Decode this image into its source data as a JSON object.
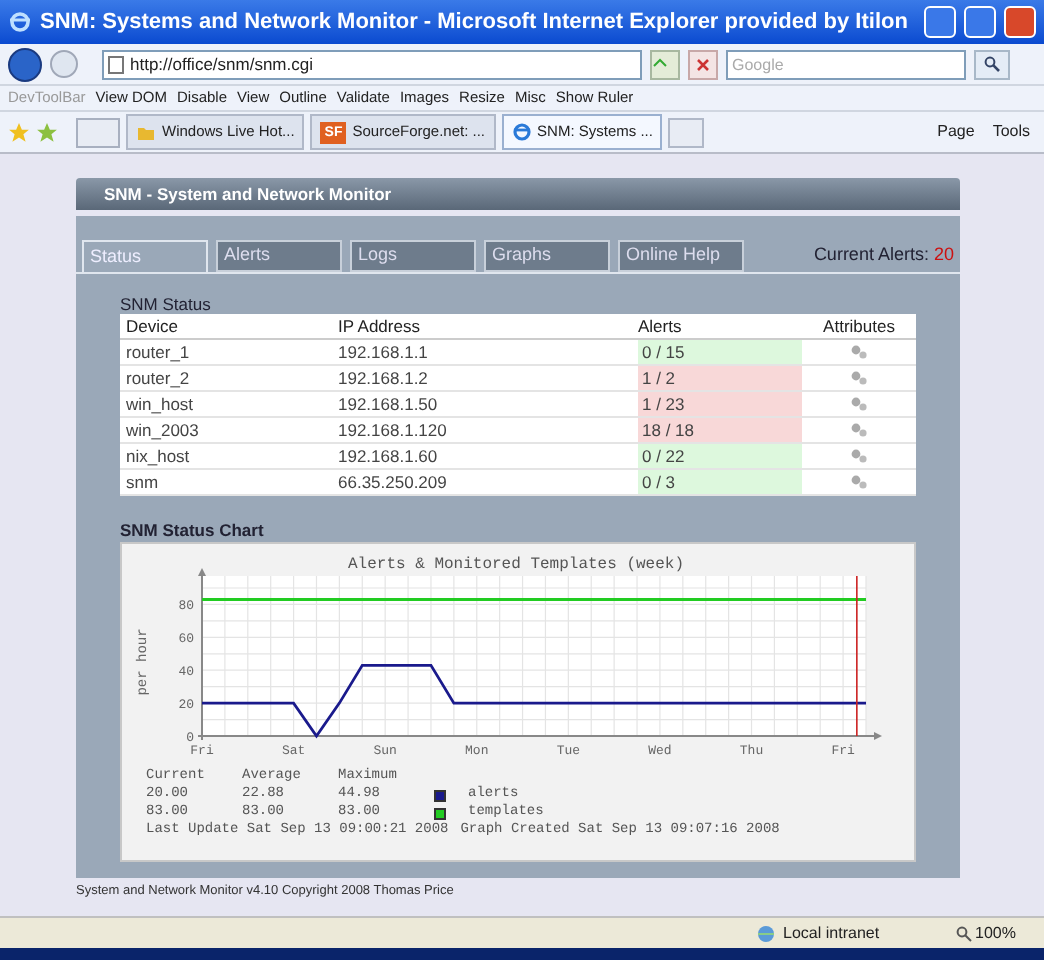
{
  "window": {
    "title": "SNM: Systems and Network Monitor - Microsoft Internet Explorer provided by Itilon"
  },
  "address_bar": {
    "url": "http://office/snm/snm.cgi"
  },
  "search": {
    "placeholder": "Google"
  },
  "devtoolbar": {
    "label": "DevToolBar",
    "items": [
      "View DOM",
      "Disable",
      "View",
      "Outline",
      "Validate",
      "Images",
      "Resize",
      "Misc",
      "Show Ruler"
    ]
  },
  "browser_tabs": [
    {
      "title": "Windows Live Hot...",
      "selected": false,
      "kind": "live"
    },
    {
      "title": "SourceForge.net: ...",
      "selected": false,
      "kind": "sf",
      "badge": "SF"
    },
    {
      "title": "SNM: Systems ...",
      "selected": true,
      "kind": "ie"
    }
  ],
  "command_bar": [
    "Page",
    "Tools"
  ],
  "page": {
    "header": "SNM - System and Network Monitor",
    "tabs": [
      {
        "label": "Status",
        "selected": true
      },
      {
        "label": "Alerts",
        "selected": false
      },
      {
        "label": "Logs",
        "selected": false
      },
      {
        "label": "Graphs",
        "selected": false
      },
      {
        "label": "Online Help",
        "selected": false
      }
    ],
    "current_alerts": {
      "label": "Current Alerts:",
      "count": "20"
    },
    "status": {
      "title": "SNM Status",
      "columns": [
        "Device",
        "IP Address",
        "Alerts",
        "Attributes"
      ],
      "rows": [
        {
          "device": "router_1",
          "ip": "192.168.1.1",
          "alerts": "0 / 15",
          "color": "#ddf8dd"
        },
        {
          "device": "router_2",
          "ip": "192.168.1.2",
          "alerts": "1 / 2",
          "color": "#f8d8d8"
        },
        {
          "device": "win_host",
          "ip": "192.168.1.50",
          "alerts": "1 / 23",
          "color": "#f8d8d8"
        },
        {
          "device": "win_2003",
          "ip": "192.168.1.120",
          "alerts": "18 / 18",
          "color": "#f8d8d8"
        },
        {
          "device": "nix_host",
          "ip": "192.168.1.60",
          "alerts": "0 / 22",
          "color": "#ddf8dd"
        },
        {
          "device": "snm",
          "ip": "66.35.250.209",
          "alerts": "0 / 3",
          "color": "#ddf8dd"
        }
      ]
    },
    "chart": {
      "title": "SNM Status Chart",
      "chart_data": {
        "type": "line",
        "title": "Alerts & Monitored Templates (week)",
        "ylabel": "per hour",
        "categories": [
          "Fri",
          null,
          null,
          null,
          "Sat",
          null,
          null,
          null,
          "Sun",
          null,
          null,
          null,
          "Mon",
          null,
          null,
          null,
          "Tue",
          null,
          null,
          null,
          "Wed",
          null,
          null,
          null,
          "Thu",
          null,
          null,
          null,
          "Fri",
          null
        ],
        "series": [
          {
            "name": "alerts",
            "color": "#1a1a8c",
            "values": [
              20,
              20,
              20,
              20,
              20,
              0,
              20,
              43,
              43,
              43,
              43,
              20,
              20,
              20,
              20,
              20,
              20,
              20,
              20,
              20,
              20,
              20,
              20,
              20,
              20,
              20,
              20,
              20,
              20,
              20
            ]
          },
          {
            "name": "templates",
            "color": "#22cc22",
            "values": [
              83,
              83,
              83,
              83,
              83,
              83,
              83,
              83,
              83,
              83,
              83,
              83,
              83,
              83,
              83,
              83,
              83,
              83,
              83,
              83,
              83,
              83,
              83,
              83,
              83,
              83,
              83,
              83,
              83,
              83
            ]
          }
        ],
        "ylim": [
          0,
          90
        ],
        "grid": true,
        "legend": "bottom",
        "yticks": [
          0,
          20,
          40,
          60,
          80
        ]
      },
      "legend": {
        "columns": [
          "Current",
          "Average",
          "Maximum"
        ],
        "rows": [
          {
            "values": [
              "20.00",
              "22.88",
              "44.98"
            ]
          },
          {
            "values": [
              "83.00",
              "83.00",
              "83.00"
            ]
          }
        ]
      },
      "last_update": "Last Update Sat Sep 13 09:00:21 2008",
      "graph_created": "Graph Created Sat Sep 13 09:07:16 2008"
    },
    "footer": "System and Network Monitor v4.10 Copyright 2008 Thomas Price"
  },
  "status_bar": {
    "zone": "Local intranet",
    "zoom": "100%"
  }
}
